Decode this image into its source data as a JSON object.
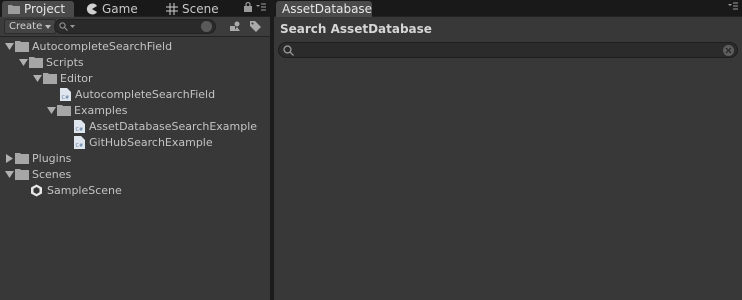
{
  "project_panel": {
    "tabs": [
      {
        "label": "Project",
        "icon": "folder-icon"
      },
      {
        "label": "Game",
        "icon": "pacman-icon"
      },
      {
        "label": "Scene",
        "icon": "grid-icon"
      }
    ],
    "create_label": "Create",
    "search_placeholder": "",
    "tree": [
      {
        "label": "AutocompleteSearchField",
        "type": "folder",
        "depth": 0,
        "expanded": true
      },
      {
        "label": "Scripts",
        "type": "folder",
        "depth": 1,
        "expanded": true
      },
      {
        "label": "Editor",
        "type": "folder",
        "depth": 2,
        "expanded": true
      },
      {
        "label": "AutocompleteSearchField",
        "type": "csharp",
        "depth": 3
      },
      {
        "label": "Examples",
        "type": "folder",
        "depth": 3,
        "expanded": true
      },
      {
        "label": "AssetDatabaseSearchExample",
        "type": "csharp",
        "depth": 4
      },
      {
        "label": "GitHubSearchExample",
        "type": "csharp",
        "depth": 4
      },
      {
        "label": "Plugins",
        "type": "folder",
        "depth": 0,
        "expanded": false
      },
      {
        "label": "Scenes",
        "type": "folder",
        "depth": 0,
        "expanded": true
      },
      {
        "label": "SampleScene",
        "type": "unity",
        "depth": 1
      }
    ]
  },
  "asset_panel": {
    "tab_label": "AssetDatabase",
    "title": "Search AssetDatabase",
    "search_value": ""
  },
  "colors": {
    "background": "#383838",
    "tab_strip": "#191919",
    "active_tab": "#4a4a4a",
    "text": "#c4c4c4"
  }
}
